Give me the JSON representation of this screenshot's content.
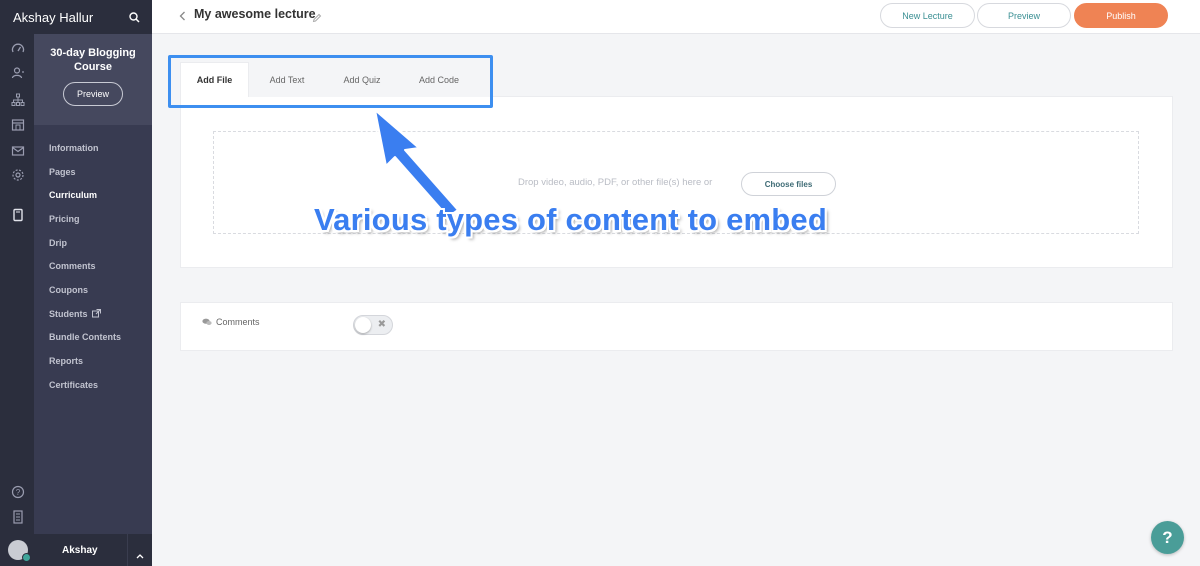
{
  "sidebar": {
    "user_name": "Akshay Hallur",
    "rail_icons": [
      "dashboard-icon",
      "users-icon",
      "sitemap-icon",
      "store-icon",
      "mail-icon",
      "settings-icon",
      "book-icon",
      "help-icon",
      "calculator-icon"
    ],
    "course": {
      "title": "30-day Blogging Course",
      "preview_label": "Preview"
    },
    "nav": [
      {
        "label": "Information"
      },
      {
        "label": "Pages"
      },
      {
        "label": "Curriculum",
        "active": true
      },
      {
        "label": "Pricing"
      },
      {
        "label": "Drip"
      },
      {
        "label": "Comments"
      },
      {
        "label": "Coupons"
      },
      {
        "label": "Students",
        "external": true
      },
      {
        "label": "Bundle Contents"
      },
      {
        "label": "Reports"
      },
      {
        "label": "Certificates"
      }
    ],
    "bottom_user": "Akshay"
  },
  "header": {
    "lecture_title": "My awesome lecture",
    "new_lecture_label": "New Lecture",
    "preview_label": "Preview",
    "publish_label": "Publish"
  },
  "tabs": [
    {
      "label": "Add File",
      "active": true
    },
    {
      "label": "Add Text"
    },
    {
      "label": "Add Quiz"
    },
    {
      "label": "Add Code"
    }
  ],
  "upload": {
    "drop_text": "Drop video, audio, PDF, or other file(s) here or",
    "choose_label": "Choose files"
  },
  "annotation": {
    "text": "Various types of content to embed"
  },
  "comments": {
    "label": "Comments",
    "enabled": false
  },
  "help": {
    "label": "?"
  },
  "colors": {
    "sidebar_dark": "#2b2e3d",
    "course_panel": "#383b51",
    "publish": "#ef8354",
    "accent_teal": "#3a8f93",
    "annotation_blue": "#3a7ef0",
    "help": "#4a9d98"
  }
}
